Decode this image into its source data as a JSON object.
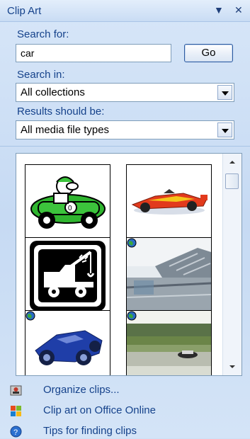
{
  "pane": {
    "title": "Clip Art",
    "dropdown_glyph": "▼",
    "close_glyph": "✕"
  },
  "search": {
    "label": "Search for:",
    "value": "car",
    "go_label": "Go"
  },
  "search_in": {
    "label": "Search in:",
    "selected": "All collections"
  },
  "results_type": {
    "label": "Results should be:",
    "selected": "All media file types"
  },
  "results": {
    "items": [
      {
        "kind": "clipart",
        "subject": "green race car cartoon"
      },
      {
        "kind": "photo",
        "subject": "red and yellow race car"
      },
      {
        "kind": "clipart",
        "subject": "tow truck sign"
      },
      {
        "kind": "photo",
        "subject": "racing car near stadium",
        "online": true
      },
      {
        "kind": "photo",
        "subject": "blue vintage car",
        "online": true
      },
      {
        "kind": "photo",
        "subject": "motion blurred car",
        "online": true
      }
    ]
  },
  "links": [
    {
      "label": "Organize clips...",
      "icon": "organizer-icon"
    },
    {
      "label": "Clip art on Office Online",
      "icon": "office-online-icon"
    },
    {
      "label": "Tips for finding clips",
      "icon": "help-icon"
    }
  ],
  "colors": {
    "accent": "#15428b",
    "pane_bg": "#c6daf3"
  }
}
